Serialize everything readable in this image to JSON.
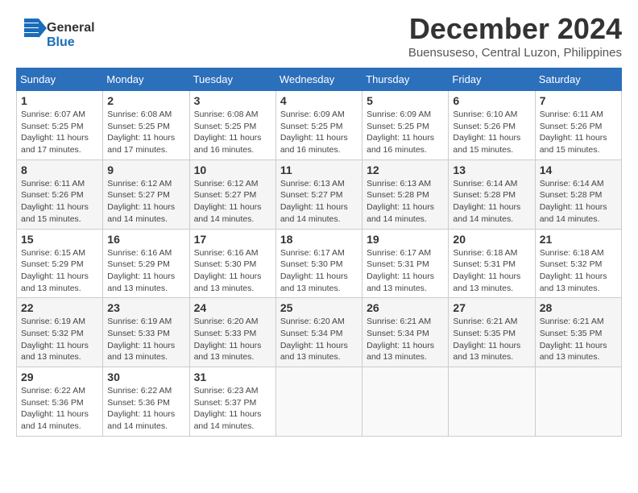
{
  "logo": {
    "general": "General",
    "blue": "Blue",
    "arrow_char": "▶"
  },
  "title": {
    "month": "December 2024",
    "location": "Buensuseso, Central Luzon, Philippines"
  },
  "weekdays": [
    "Sunday",
    "Monday",
    "Tuesday",
    "Wednesday",
    "Thursday",
    "Friday",
    "Saturday"
  ],
  "weeks": [
    [
      {
        "day": "1",
        "info": "Sunrise: 6:07 AM\nSunset: 5:25 PM\nDaylight: 11 hours and 17 minutes."
      },
      {
        "day": "2",
        "info": "Sunrise: 6:08 AM\nSunset: 5:25 PM\nDaylight: 11 hours and 17 minutes."
      },
      {
        "day": "3",
        "info": "Sunrise: 6:08 AM\nSunset: 5:25 PM\nDaylight: 11 hours and 16 minutes."
      },
      {
        "day": "4",
        "info": "Sunrise: 6:09 AM\nSunset: 5:25 PM\nDaylight: 11 hours and 16 minutes."
      },
      {
        "day": "5",
        "info": "Sunrise: 6:09 AM\nSunset: 5:25 PM\nDaylight: 11 hours and 16 minutes."
      },
      {
        "day": "6",
        "info": "Sunrise: 6:10 AM\nSunset: 5:26 PM\nDaylight: 11 hours and 15 minutes."
      },
      {
        "day": "7",
        "info": "Sunrise: 6:11 AM\nSunset: 5:26 PM\nDaylight: 11 hours and 15 minutes."
      }
    ],
    [
      {
        "day": "8",
        "info": "Sunrise: 6:11 AM\nSunset: 5:26 PM\nDaylight: 11 hours and 15 minutes."
      },
      {
        "day": "9",
        "info": "Sunrise: 6:12 AM\nSunset: 5:27 PM\nDaylight: 11 hours and 14 minutes."
      },
      {
        "day": "10",
        "info": "Sunrise: 6:12 AM\nSunset: 5:27 PM\nDaylight: 11 hours and 14 minutes."
      },
      {
        "day": "11",
        "info": "Sunrise: 6:13 AM\nSunset: 5:27 PM\nDaylight: 11 hours and 14 minutes."
      },
      {
        "day": "12",
        "info": "Sunrise: 6:13 AM\nSunset: 5:28 PM\nDaylight: 11 hours and 14 minutes."
      },
      {
        "day": "13",
        "info": "Sunrise: 6:14 AM\nSunset: 5:28 PM\nDaylight: 11 hours and 14 minutes."
      },
      {
        "day": "14",
        "info": "Sunrise: 6:14 AM\nSunset: 5:28 PM\nDaylight: 11 hours and 14 minutes."
      }
    ],
    [
      {
        "day": "15",
        "info": "Sunrise: 6:15 AM\nSunset: 5:29 PM\nDaylight: 11 hours and 13 minutes."
      },
      {
        "day": "16",
        "info": "Sunrise: 6:16 AM\nSunset: 5:29 PM\nDaylight: 11 hours and 13 minutes."
      },
      {
        "day": "17",
        "info": "Sunrise: 6:16 AM\nSunset: 5:30 PM\nDaylight: 11 hours and 13 minutes."
      },
      {
        "day": "18",
        "info": "Sunrise: 6:17 AM\nSunset: 5:30 PM\nDaylight: 11 hours and 13 minutes."
      },
      {
        "day": "19",
        "info": "Sunrise: 6:17 AM\nSunset: 5:31 PM\nDaylight: 11 hours and 13 minutes."
      },
      {
        "day": "20",
        "info": "Sunrise: 6:18 AM\nSunset: 5:31 PM\nDaylight: 11 hours and 13 minutes."
      },
      {
        "day": "21",
        "info": "Sunrise: 6:18 AM\nSunset: 5:32 PM\nDaylight: 11 hours and 13 minutes."
      }
    ],
    [
      {
        "day": "22",
        "info": "Sunrise: 6:19 AM\nSunset: 5:32 PM\nDaylight: 11 hours and 13 minutes."
      },
      {
        "day": "23",
        "info": "Sunrise: 6:19 AM\nSunset: 5:33 PM\nDaylight: 11 hours and 13 minutes."
      },
      {
        "day": "24",
        "info": "Sunrise: 6:20 AM\nSunset: 5:33 PM\nDaylight: 11 hours and 13 minutes."
      },
      {
        "day": "25",
        "info": "Sunrise: 6:20 AM\nSunset: 5:34 PM\nDaylight: 11 hours and 13 minutes."
      },
      {
        "day": "26",
        "info": "Sunrise: 6:21 AM\nSunset: 5:34 PM\nDaylight: 11 hours and 13 minutes."
      },
      {
        "day": "27",
        "info": "Sunrise: 6:21 AM\nSunset: 5:35 PM\nDaylight: 11 hours and 13 minutes."
      },
      {
        "day": "28",
        "info": "Sunrise: 6:21 AM\nSunset: 5:35 PM\nDaylight: 11 hours and 13 minutes."
      }
    ],
    [
      {
        "day": "29",
        "info": "Sunrise: 6:22 AM\nSunset: 5:36 PM\nDaylight: 11 hours and 14 minutes."
      },
      {
        "day": "30",
        "info": "Sunrise: 6:22 AM\nSunset: 5:36 PM\nDaylight: 11 hours and 14 minutes."
      },
      {
        "day": "31",
        "info": "Sunrise: 6:23 AM\nSunset: 5:37 PM\nDaylight: 11 hours and 14 minutes."
      },
      null,
      null,
      null,
      null
    ]
  ]
}
